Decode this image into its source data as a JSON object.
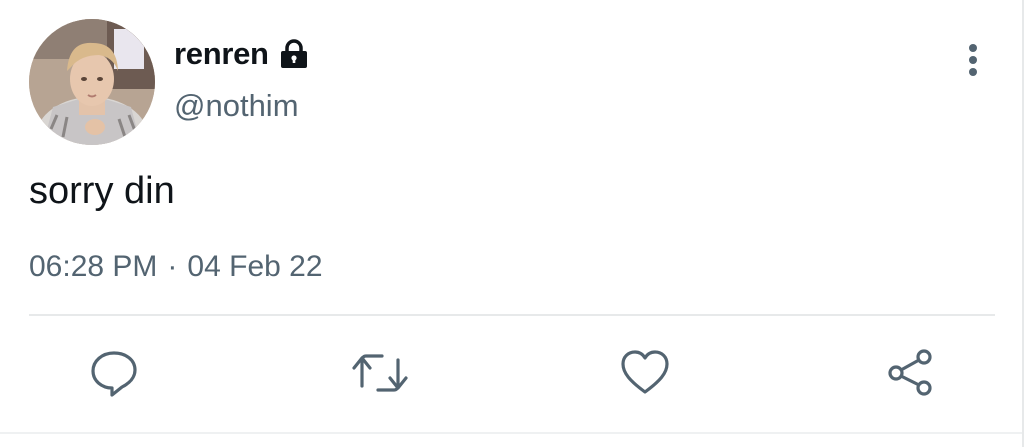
{
  "tweet": {
    "display_name": "renren",
    "handle": "@nothim",
    "protected": true,
    "text": "sorry din",
    "time": "06:28 PM",
    "separator": "·",
    "date": "04 Feb 22"
  },
  "icons": {
    "lock": "lock-icon",
    "more": "more-vertical-icon",
    "reply": "reply-icon",
    "retweet": "retweet-icon",
    "like": "heart-icon",
    "share": "share-icon"
  },
  "colors": {
    "text_primary": "#0f1419",
    "text_secondary": "#536471",
    "icon_gray": "#536471",
    "divider": "#e7e9ea"
  }
}
